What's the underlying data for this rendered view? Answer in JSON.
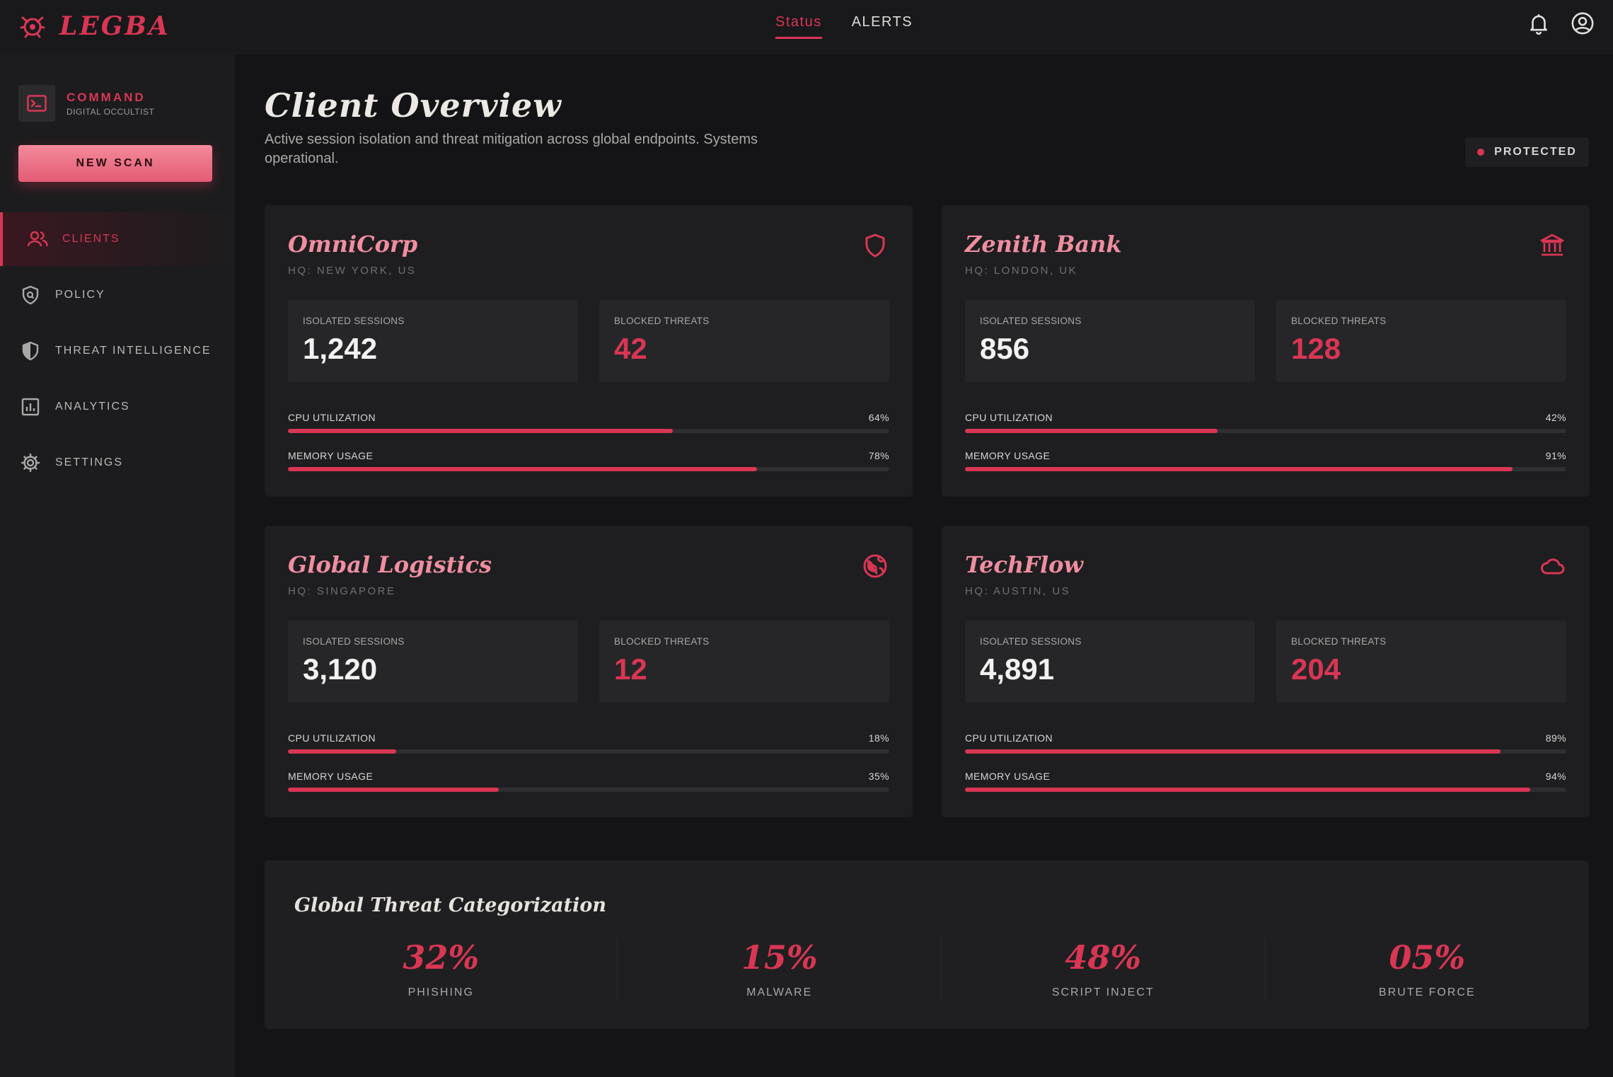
{
  "brand": {
    "name": "LEGBA"
  },
  "topnav": {
    "items": [
      {
        "label": "Status",
        "active": true
      },
      {
        "label": "ALERTS",
        "active": false
      }
    ]
  },
  "top_icons": [
    "bell-icon",
    "account-circle-icon"
  ],
  "sidebar": {
    "command_title": "COMMAND",
    "command_subtitle": "DIGITAL OCCULTIST",
    "new_scan_label": "NEW SCAN",
    "items": [
      {
        "label": "CLIENTS",
        "icon": "users-icon",
        "active": true
      },
      {
        "label": "POLICY",
        "icon": "policy-shield-icon",
        "active": false
      },
      {
        "label": "THREAT INTELLIGENCE",
        "icon": "shield-half-icon",
        "active": false
      },
      {
        "label": "ANALYTICS",
        "icon": "bar-chart-icon",
        "active": false
      },
      {
        "label": "SETTINGS",
        "icon": "gear-icon",
        "active": false
      }
    ]
  },
  "header": {
    "title": "Client Overview",
    "description": "Active session isolation and threat mitigation across global endpoints. Systems operational.",
    "status_badge": "PROTECTED"
  },
  "clients": [
    {
      "name": "OmniCorp",
      "hq": "HQ: NEW YORK, US",
      "icon": "shield-icon",
      "isolated_label": "ISOLATED SESSIONS",
      "isolated": "1,242",
      "blocked_label": "BLOCKED THREATS",
      "blocked": "42",
      "cpu_label": "CPU UTILIZATION",
      "cpu": "64%",
      "cpu_value": 64,
      "mem_label": "MEMORY USAGE",
      "mem": "78%",
      "mem_value": 78
    },
    {
      "name": "Zenith Bank",
      "hq": "HQ: LONDON, UK",
      "icon": "bank-icon",
      "isolated_label": "ISOLATED SESSIONS",
      "isolated": "856",
      "blocked_label": "BLOCKED THREATS",
      "blocked": "128",
      "cpu_label": "CPU UTILIZATION",
      "cpu": "42%",
      "cpu_value": 42,
      "mem_label": "MEMORY USAGE",
      "mem": "91%",
      "mem_value": 91
    },
    {
      "name": "Global Logistics",
      "hq": "HQ: SINGAPORE",
      "icon": "globe-icon",
      "isolated_label": "ISOLATED SESSIONS",
      "isolated": "3,120",
      "blocked_label": "BLOCKED THREATS",
      "blocked": "12",
      "cpu_label": "CPU UTILIZATION",
      "cpu": "18%",
      "cpu_value": 18,
      "mem_label": "MEMORY USAGE",
      "mem": "35%",
      "mem_value": 35
    },
    {
      "name": "TechFlow",
      "hq": "HQ: AUSTIN, US",
      "icon": "cloud-icon",
      "isolated_label": "ISOLATED SESSIONS",
      "isolated": "4,891",
      "blocked_label": "BLOCKED THREATS",
      "blocked": "204",
      "cpu_label": "CPU UTILIZATION",
      "cpu": "89%",
      "cpu_value": 89,
      "mem_label": "MEMORY USAGE",
      "mem": "94%",
      "mem_value": 94
    }
  ],
  "threat_categorization": {
    "title": "Global Threat Categorization",
    "categories": [
      {
        "pct": "32%",
        "label": "PHISHING"
      },
      {
        "pct": "15%",
        "label": "MALWARE"
      },
      {
        "pct": "48%",
        "label": "SCRIPT INJECT"
      },
      {
        "pct": "05%",
        "label": "BRUTE FORCE"
      }
    ]
  },
  "colors": {
    "accent": "#d93654",
    "accent_light": "#f08ea0",
    "background": "#141416",
    "card": "#1e1e20"
  }
}
